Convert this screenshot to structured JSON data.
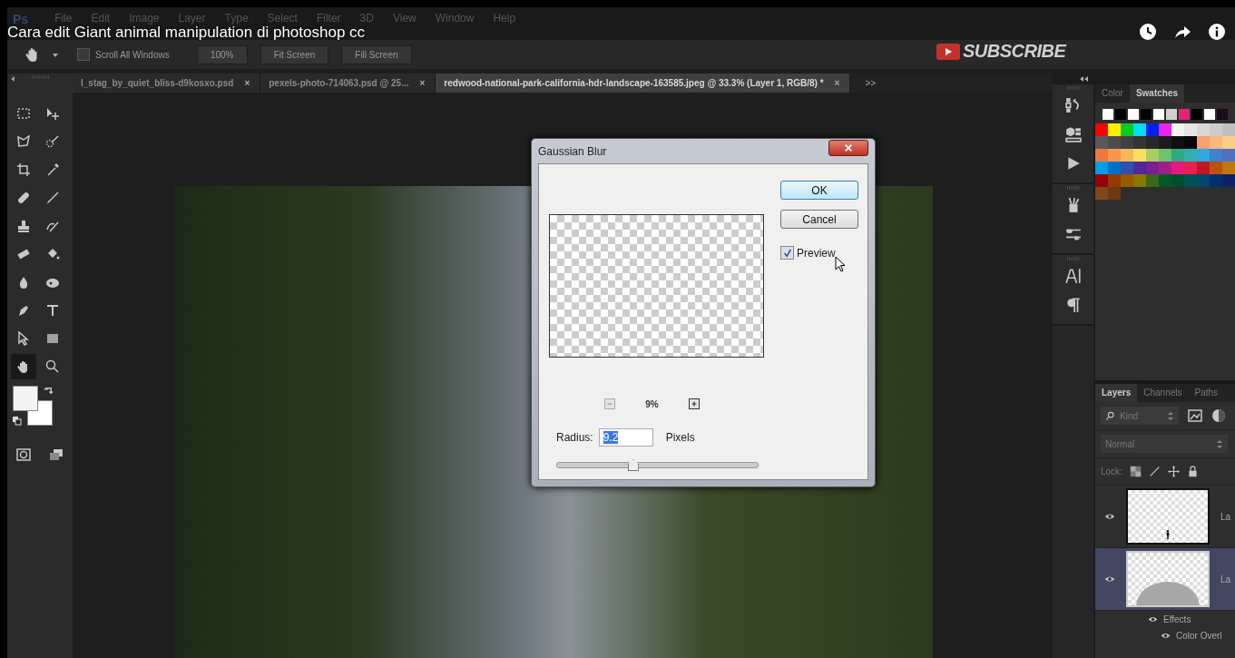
{
  "video_overlay": {
    "title": "Cara edit Giant animal manipulation di photoshop cc",
    "subscribe": "SUBSCRIBE"
  },
  "menu_bar": {
    "logo": "Ps",
    "items": [
      "File",
      "Edit",
      "Image",
      "Layer",
      "Type",
      "Select",
      "Filter",
      "3D",
      "View",
      "Window",
      "Help"
    ]
  },
  "options_bar": {
    "scroll_all_windows": {
      "label": "Scroll All Windows",
      "checked": false
    },
    "buttons": [
      "100%",
      "Fit Screen",
      "Fill Screen"
    ]
  },
  "document_tabs": [
    {
      "label": "l_stag_by_quiet_bliss-d9kosxo.psd",
      "close": "×",
      "selected": false
    },
    {
      "label": "pexels-photo-714063.psd @ 25...",
      "close": "×",
      "selected": false
    },
    {
      "label": "redwood-national-park-california-hdr-landscape-163585.jpeg @ 33.3% (Layer 1, RGB/8) *",
      "close": "×",
      "selected": true
    }
  ],
  "tabs_overflow": ">>",
  "tools": [
    {
      "selected": false
    },
    {
      "selected": false
    },
    {
      "selected": false
    },
    {
      "selected": false
    },
    {
      "selected": false
    },
    {
      "selected": false
    },
    {
      "selected": false
    },
    {
      "selected": false
    },
    {
      "selected": false
    },
    {
      "selected": false
    },
    {
      "selected": false
    },
    {
      "selected": false
    },
    {
      "selected": false
    },
    {
      "selected": false
    },
    {
      "selected": false
    },
    {
      "selected": false
    },
    {
      "selected": false
    },
    {
      "selected": false
    },
    {
      "selected": true
    },
    {
      "selected": false
    }
  ],
  "dialog": {
    "title": "Gaussian Blur",
    "ok": "OK",
    "cancel": "Cancel",
    "preview": {
      "label": "Preview",
      "checked": true
    },
    "zoom": "9%",
    "radius_label": "Radius:",
    "radius_value": "9.2",
    "radius_value_highlighted": true,
    "unit": "Pixels",
    "radius_slider": {
      "level": 0.375
    }
  },
  "top_panel_tabs": [
    {
      "label": "Color",
      "selected": false
    },
    {
      "label": "Swatches",
      "selected": true
    }
  ],
  "swatches": {
    "top_row": [
      {
        "color": "#ffffff"
      },
      {
        "color": "#000000"
      },
      {
        "color": "#ffffff"
      },
      {
        "color": "#000000"
      },
      {
        "color": "#ffffff"
      },
      {
        "color": "#d0d0d0"
      },
      {
        "color": "#e8207a"
      },
      {
        "color": "#000000"
      },
      {
        "color": "#ffffff"
      },
      {
        "color": "#1a0a1a"
      }
    ],
    "grid": [
      [
        {
          "color": "#ff0000"
        },
        {
          "color": "#ffee00"
        },
        {
          "color": "#00cc22"
        },
        {
          "color": "#00ddee"
        },
        {
          "color": "#0022ee"
        },
        {
          "color": "#ee22ee"
        },
        {
          "color": "#f4f4f4"
        },
        {
          "color": "#e4e4e4"
        },
        {
          "color": "#d8d8d8"
        },
        {
          "color": "#cccccc"
        },
        {
          "color": "#c0c0c0"
        }
      ],
      [
        {
          "color": "#585858"
        },
        {
          "color": "#4c4c4c"
        },
        {
          "color": "#404040"
        },
        {
          "color": "#343434"
        },
        {
          "color": "#282828"
        },
        {
          "color": "#1c1c1c"
        },
        {
          "color": "#101010"
        },
        {
          "color": "#080808"
        },
        {
          "color": "#f4a070"
        },
        {
          "color": "#f8b880"
        },
        {
          "color": "#fccc88"
        }
      ],
      [
        {
          "color": "#f07840"
        },
        {
          "color": "#f89850"
        },
        {
          "color": "#f8b858"
        },
        {
          "color": "#f8e060"
        },
        {
          "color": "#a8d060"
        },
        {
          "color": "#70c070"
        },
        {
          "color": "#30a880"
        },
        {
          "color": "#30b0b0"
        },
        {
          "color": "#30a8e0"
        },
        {
          "color": "#4080d0"
        },
        {
          "color": "#5070c0"
        }
      ],
      [
        {
          "color": "#00a0e8"
        },
        {
          "color": "#0070c8"
        },
        {
          "color": "#3050b0"
        },
        {
          "color": "#502898"
        },
        {
          "color": "#782090"
        },
        {
          "color": "#a02088"
        },
        {
          "color": "#e81880"
        },
        {
          "color": "#e82050"
        },
        {
          "color": "#c01820"
        },
        {
          "color": "#c05010"
        },
        {
          "color": "#c07810"
        }
      ],
      [
        {
          "color": "#980010"
        },
        {
          "color": "#983808"
        },
        {
          "color": "#985800"
        },
        {
          "color": "#887800"
        },
        {
          "color": "#3a6818"
        },
        {
          "color": "#005828"
        },
        {
          "color": "#005030"
        },
        {
          "color": "#005050"
        },
        {
          "color": "#004870"
        },
        {
          "color": "#003070"
        },
        {
          "color": "#102068"
        }
      ],
      [
        {
          "color": "#804818"
        },
        {
          "color": "#6a3a10"
        }
      ]
    ]
  },
  "layers_panel": {
    "tabs": [
      {
        "label": "Layers",
        "selected": true
      },
      {
        "label": "Channels",
        "selected": false
      },
      {
        "label": "Paths",
        "selected": false
      }
    ],
    "filter": "Kind",
    "blend_mode": "Normal",
    "lock_label": "Lock:",
    "layers": [
      {
        "name": "La",
        "kind": "figure",
        "selected": false
      },
      {
        "name": "La",
        "kind": "arc",
        "selected": true
      }
    ],
    "effects": [
      {
        "label": "Effects",
        "kind": "header"
      },
      {
        "label": "Color Overl",
        "kind": "item"
      }
    ]
  }
}
